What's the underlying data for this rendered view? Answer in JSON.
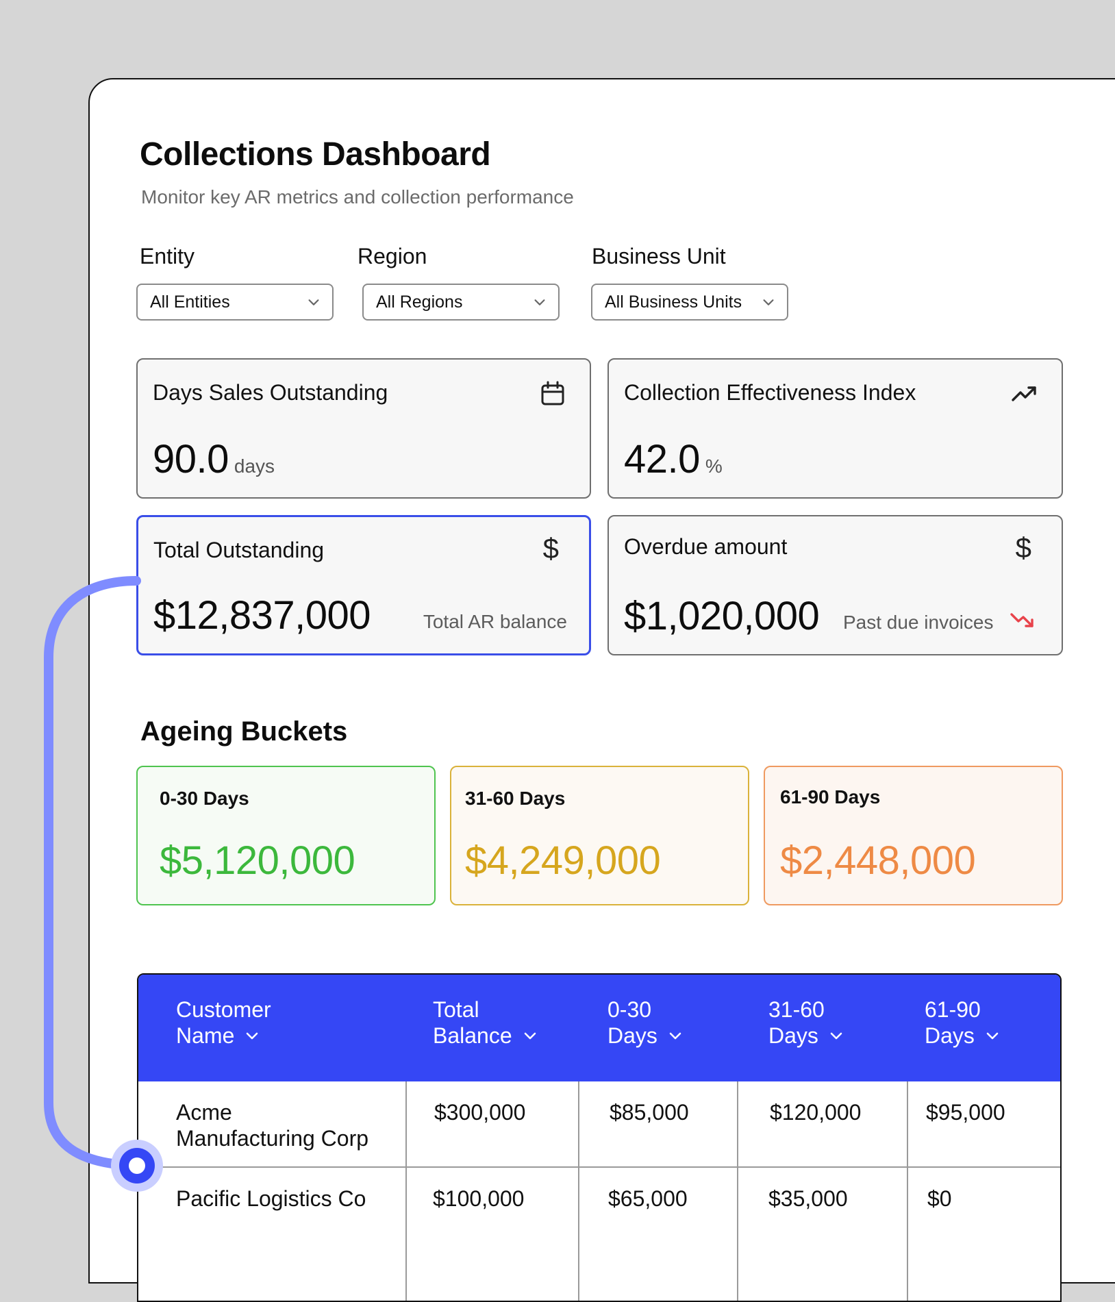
{
  "header": {
    "title": "Collections Dashboard",
    "subtitle": "Monitor key AR metrics and collection performance"
  },
  "filters": [
    {
      "label": "Entity",
      "value": "All Entities"
    },
    {
      "label": "Region",
      "value": "All Regions"
    },
    {
      "label": "Business Unit",
      "value": "All Business Units"
    }
  ],
  "metrics": {
    "dso": {
      "title": "Days Sales Outstanding",
      "value": "90.0",
      "unit": "days",
      "icon": "calendar-icon"
    },
    "cei": {
      "title": "Collection Effectiveness Index",
      "value": "42.0",
      "unit": "%",
      "icon": "trending-up-icon"
    },
    "total_outstanding": {
      "title": "Total Outstanding",
      "value": "$12,837,000",
      "note": "Total AR balance",
      "icon": "dollar-icon",
      "symbol": "$"
    },
    "overdue": {
      "title": "Overdue amount",
      "value": "$1,020,000",
      "note": "Past due invoices",
      "icon": "dollar-icon",
      "symbol": "$",
      "trend_icon": "trending-down-icon"
    }
  },
  "ageing": {
    "title": "Ageing Buckets",
    "buckets": [
      {
        "label": "0-30 Days",
        "value": "$5,120,000",
        "color": "#3cb83c",
        "bg": "#f6fbf5",
        "border": "#4fc44f"
      },
      {
        "label": "31-60 Days",
        "value": "$4,249,000",
        "color": "#d6a61e",
        "bg": "#fdf9f3",
        "border": "#dab23a"
      },
      {
        "label": "61-90 Days",
        "value": "$2,448,000",
        "color": "#ee8a45",
        "bg": "#fdf6f1",
        "border": "#ef9a60"
      }
    ]
  },
  "table": {
    "columns": [
      {
        "line1": "Customer",
        "line2": "Name"
      },
      {
        "line1": "Total",
        "line2": "Balance"
      },
      {
        "line1": "0-30",
        "line2": "Days"
      },
      {
        "line1": "31-60",
        "line2": "Days"
      },
      {
        "line1": "61-90",
        "line2": "Days"
      }
    ],
    "rows": [
      {
        "customer_line1": "Acme",
        "customer_line2": "Manufacturing Corp",
        "total": "$300,000",
        "d0_30": "$85,000",
        "d31_60": "$120,000",
        "d61_90": "$95,000"
      },
      {
        "customer_line1": "Pacific Logistics Co",
        "customer_line2": "",
        "total": "$100,000",
        "d0_30": "$65,000",
        "d31_60": "$35,000",
        "d61_90": "$0"
      }
    ]
  },
  "colors": {
    "accent": "#3547f5",
    "connector": "#7f8cff",
    "selected_border": "#3a4ee8",
    "trend_down": "#e8434b"
  }
}
